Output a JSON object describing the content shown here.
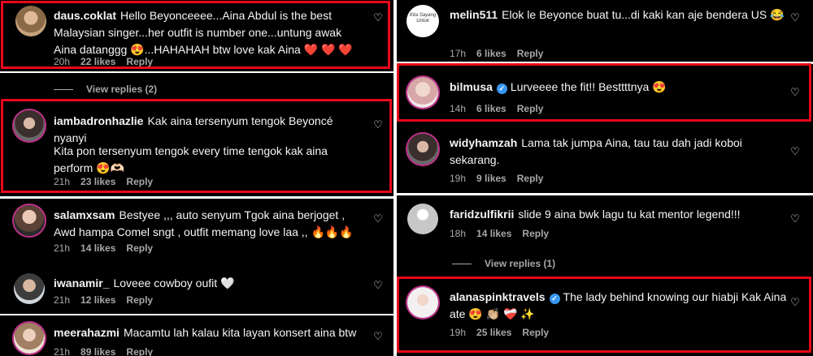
{
  "left": {
    "comments": [
      {
        "user": "daus.coklat",
        "text": "Hello Beyonceeee...Aina Abdul is the best Malaysian singer...her outfit is number one...untung awak Aina datanggg 😍...HAHAHAH btw love kak Aina ❤️ ❤️ ❤️",
        "age": "20h",
        "likes": "22 likes",
        "reply": "Reply",
        "view_replies": "View replies (2)"
      },
      {
        "user": "iambadronhazlie",
        "text": "Kak aina tersenyum tengok Beyoncé nyanyi",
        "text2": "Kita pon tersenyum tengok every time tengok kak aina perform 😍🫶🏻",
        "age": "21h",
        "likes": "23 likes",
        "reply": "Reply"
      },
      {
        "user": "salamxsam",
        "text": "Bestyee ,,, auto senyum Tgok aina berjoget , Awd hampa Comel sngt , outfit memang love laa ,, 🔥🔥🔥",
        "age": "21h",
        "likes": "14 likes",
        "reply": "Reply"
      },
      {
        "user": "iwanamir_",
        "text": "Loveee cowboy oufit 🤍",
        "age": "21h",
        "likes": "12 likes",
        "reply": "Reply"
      },
      {
        "user": "meerahazmi",
        "text": "Macamtu lah kalau kita layan konsert aina btw",
        "age": "21h",
        "likes": "89 likes",
        "reply": "Reply"
      }
    ]
  },
  "right": {
    "comments": [
      {
        "user": "melin511",
        "text": "Elok le Beyonce buat tu...di kaki kan aje bendera US 😂",
        "age": "17h",
        "likes": "6 likes",
        "reply": "Reply"
      },
      {
        "user": "bilmusa",
        "verified": true,
        "text": "Lurveeee the fit!! Besttttnya 😍",
        "age": "14h",
        "likes": "6 likes",
        "reply": "Reply"
      },
      {
        "user": "widyhamzah",
        "text": "Lama tak jumpa Aina, tau tau dah jadi koboi sekarang.",
        "age": "19h",
        "likes": "9 likes",
        "reply": "Reply"
      },
      {
        "user": "faridzulfikrii",
        "text": "slide 9 aina bwk lagu tu kat mentor legend!!!",
        "age": "18h",
        "likes": "14 likes",
        "reply": "Reply",
        "view_replies": "View replies (1)"
      },
      {
        "user": "alanaspinktravels",
        "verified": true,
        "text": "The lady behind knowing our hiabji Kak Aina ate 😍 👏🏼 ❤️‍🩹 ✨",
        "age": "19h",
        "likes": "25 likes",
        "reply": "Reply"
      }
    ]
  },
  "icons": {
    "heart": "heart-outline-icon",
    "verified": "verified-badge-icon"
  },
  "colors": {
    "highlight": "#e8081b",
    "background": "#000000",
    "meta": "#a8a8a8",
    "verified": "#3897f0"
  },
  "avatar_logo_text": "Kita Sayang Untuk"
}
